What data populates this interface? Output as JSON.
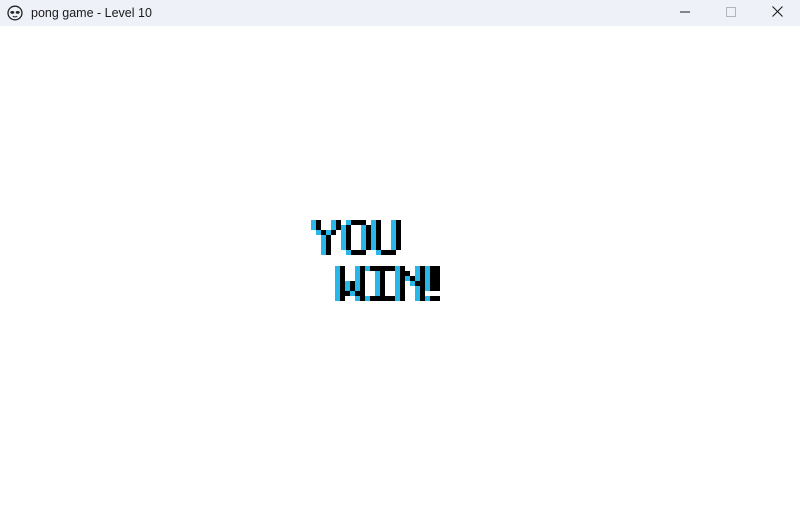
{
  "window": {
    "title": "pong game - Level 10",
    "app_icon": "alien-face-icon",
    "controls": {
      "minimize_icon": "minimize-icon",
      "maximize_icon": "maximize-icon",
      "close_icon": "close-icon"
    }
  },
  "game": {
    "message_line1": "YOU",
    "message_line2": "WIN!",
    "colors": {
      "text": "#000000",
      "shadow": "#29b6e8",
      "background": "#ffffff"
    }
  }
}
